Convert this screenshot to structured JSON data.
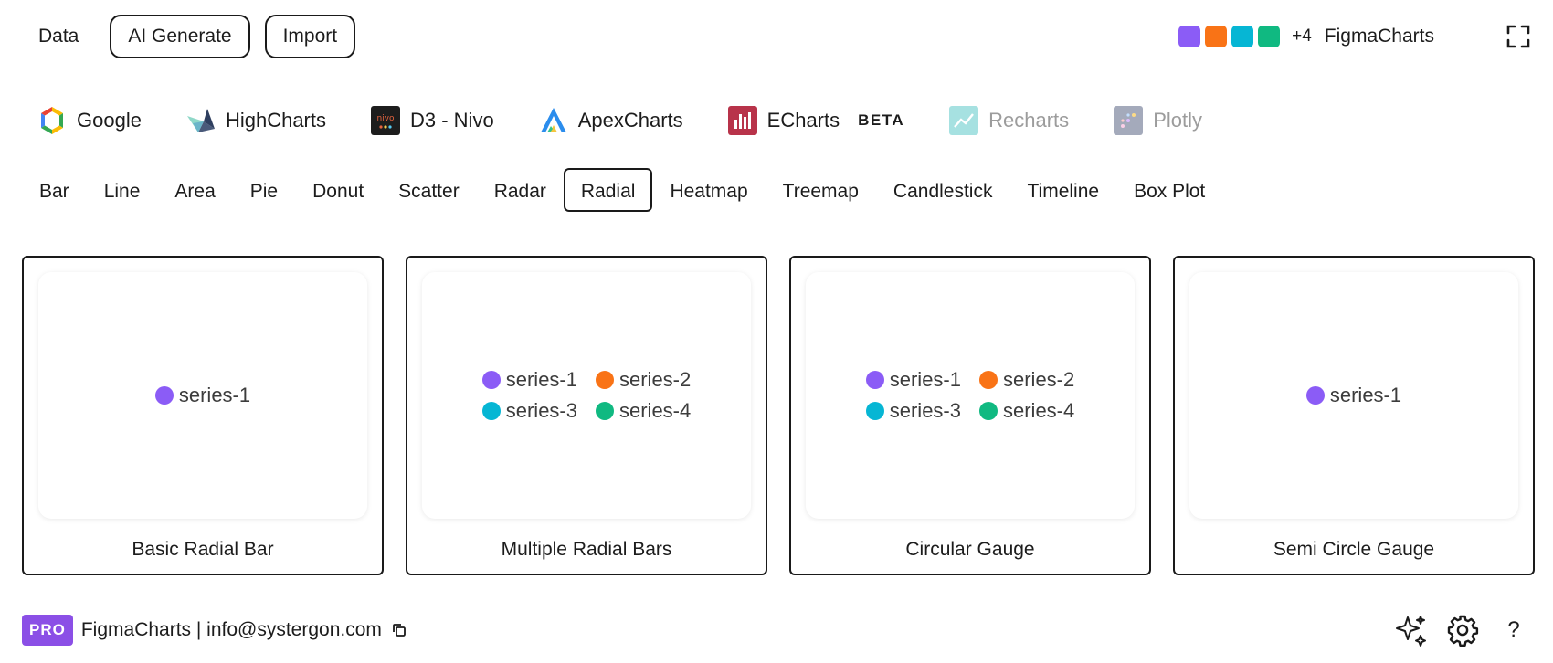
{
  "topbar": {
    "data_label": "Data",
    "ai_generate_label": "AI Generate",
    "import_label": "Import",
    "swatch_colors": [
      "#8b5cf6",
      "#f97316",
      "#06b6d4",
      "#10b981"
    ],
    "more_count": "+4",
    "brand": "FigmaCharts"
  },
  "libraries": [
    {
      "label": "Google",
      "icon": "google-charts-icon"
    },
    {
      "label": "HighCharts",
      "icon": "highcharts-icon"
    },
    {
      "label": "D3 - Nivo",
      "icon": "nivo-icon"
    },
    {
      "label": "ApexCharts",
      "icon": "apexcharts-icon"
    },
    {
      "label": "ECharts",
      "icon": "echarts-icon",
      "badge": "BETA"
    },
    {
      "label": "Recharts",
      "icon": "recharts-icon"
    },
    {
      "label": "Plotly",
      "icon": "plotly-icon"
    }
  ],
  "chart_types": [
    "Bar",
    "Line",
    "Area",
    "Pie",
    "Donut",
    "Scatter",
    "Radar",
    "Radial",
    "Heatmap",
    "Treemap",
    "Candlestick",
    "Timeline",
    "Box Plot"
  ],
  "active_chart_type": "Radial",
  "cards": [
    {
      "title": "Basic Radial Bar",
      "legend": [
        {
          "name": "series-1",
          "color": "#8b5cf6"
        }
      ]
    },
    {
      "title": "Multiple Radial Bars",
      "legend": [
        {
          "name": "series-1",
          "color": "#8b5cf6"
        },
        {
          "name": "series-2",
          "color": "#f97316"
        },
        {
          "name": "series-3",
          "color": "#06b6d4"
        },
        {
          "name": "series-4",
          "color": "#10b981"
        }
      ]
    },
    {
      "title": "Circular Gauge",
      "legend": [
        {
          "name": "series-1",
          "color": "#8b5cf6"
        },
        {
          "name": "series-2",
          "color": "#f97316"
        },
        {
          "name": "series-3",
          "color": "#06b6d4"
        },
        {
          "name": "series-4",
          "color": "#10b981"
        }
      ]
    },
    {
      "title": "Semi Circle Gauge",
      "legend": [
        {
          "name": "series-1",
          "color": "#8b5cf6"
        }
      ]
    }
  ],
  "footer": {
    "pro_badge": "PRO",
    "info_text": "FigmaCharts | info@systergon.com",
    "help": "?"
  }
}
